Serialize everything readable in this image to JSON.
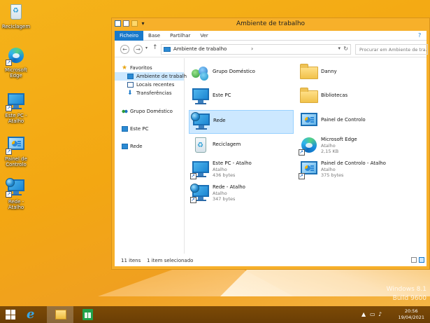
{
  "desktop": {
    "icons": [
      {
        "label": "Reciclagem"
      },
      {
        "label": "Microsoft Edge"
      },
      {
        "label": "Este PC - Atalho"
      },
      {
        "label": "Painel de Controlo"
      },
      {
        "label": "Rede - Atalho"
      }
    ],
    "watermark": {
      "line1": "Windows 8.1",
      "line2": "Build 9600"
    }
  },
  "window": {
    "title": "Ambiente de trabalho",
    "ribbon_tabs": [
      {
        "label": "Ficheiro"
      },
      {
        "label": "Base"
      },
      {
        "label": "Partilhar"
      },
      {
        "label": "Ver"
      }
    ],
    "help": "?",
    "address": {
      "crumb": "Ambiente de trabalho",
      "separator": "›"
    },
    "search": {
      "placeholder": "Procurar em Ambiente de tra..."
    },
    "nav_pane": [
      {
        "label": "Favoritos"
      },
      {
        "label": "Ambiente de trabalh"
      },
      {
        "label": "Locais recentes"
      },
      {
        "label": "Transferências"
      },
      {
        "label": "Grupo Doméstico"
      },
      {
        "label": "Este PC"
      },
      {
        "label": "Rede"
      }
    ],
    "items": [
      {
        "name": "Grupo Doméstico"
      },
      {
        "name": "Danny"
      },
      {
        "name": "Este PC"
      },
      {
        "name": "Bibliotecas"
      },
      {
        "name": "Rede"
      },
      {
        "name": "Painel de Controlo"
      },
      {
        "name": "Reciclagem"
      },
      {
        "name": "Microsoft Edge",
        "type": "Atalho",
        "size": "2,15 KB"
      },
      {
        "name": "Este PC - Atalho",
        "type": "Atalho",
        "size": "436 bytes"
      },
      {
        "name": "Painel de Controlo - Atalho",
        "type": "Atalho",
        "size": "375 bytes"
      },
      {
        "name": "Rede - Atalho",
        "type": "Atalho",
        "size": "347 bytes"
      }
    ],
    "status": {
      "count": "11 itens",
      "selected": "1 item selecionado"
    }
  },
  "taskbar": {
    "time": "20:56",
    "date": "19/04/2021"
  },
  "colors": {
    "wallpaper": "#f3a712",
    "accent": "#1979ca",
    "selection": "#cce8ff",
    "taskbar": "#6a3e05"
  }
}
